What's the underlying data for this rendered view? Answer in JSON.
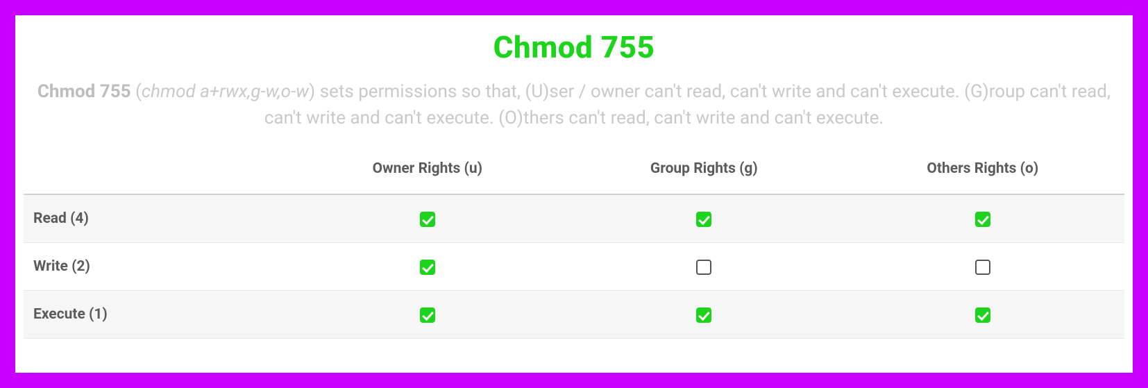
{
  "title": "Chmod 755",
  "description": {
    "lead_strong": "Chmod 755",
    "paren_open": " (",
    "symbolic_italic": "chmod a+rwx,g-w,o-w",
    "rest": ") sets permissions so that, (U)ser / owner can't read, can't write and can't execute. (G)roup can't read, can't write and can't execute. (O)thers can't read, can't write and can't execute."
  },
  "columns": {
    "empty": "",
    "owner": "Owner Rights (u)",
    "group": "Group Rights (g)",
    "others": "Others Rights (o)"
  },
  "rows": {
    "read": {
      "label": "Read (4)",
      "owner": true,
      "group": true,
      "others": true
    },
    "write": {
      "label": "Write (2)",
      "owner": true,
      "group": false,
      "others": false
    },
    "execute": {
      "label": "Execute (1)",
      "owner": true,
      "group": true,
      "others": true
    }
  }
}
